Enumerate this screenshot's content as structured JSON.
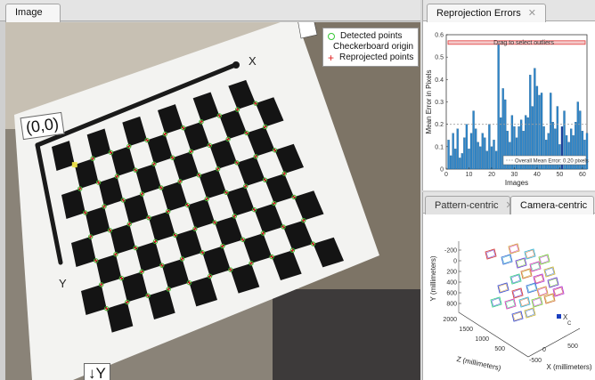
{
  "image_tab": {
    "label": "Image"
  },
  "legend": {
    "detected": "Detected points",
    "origin": "Checkerboard origin",
    "reprojected": "Reprojected points"
  },
  "overlay": {
    "origin_label": "(0,0)",
    "x_label": "X",
    "y_label": "Y",
    "y_arrow_label": "↓Y"
  },
  "reprojection_tab": {
    "label": "Reprojection Errors"
  },
  "pattern_tab": {
    "label": "Pattern-centric"
  },
  "camera_tab": {
    "label": "Camera-centric"
  },
  "colors": {
    "bar": "#2f86c9",
    "bar_edge": "#17517e",
    "mean_line": "#a0a0a0",
    "select_bar": "#e23b3b",
    "detected": "#37c837",
    "origin": "#f2e64c",
    "reprojected": "#e02020"
  },
  "chart_data": {
    "type": "bar",
    "ylabel": "Mean Error in Pixels",
    "xlabel": "Images",
    "drag_hint": "Drag to select outliers",
    "mean_label": "Overall Mean Error: 0.20 pixels",
    "mean_value": 0.2,
    "ylim": [
      0,
      0.6
    ],
    "xlim": [
      0,
      62
    ],
    "yticks": [
      "0",
      "0.1",
      "0.2",
      "0.3",
      "0.4",
      "0.5",
      "0.6"
    ],
    "xticks": [
      "0",
      "10",
      "20",
      "30",
      "40",
      "50",
      "60"
    ],
    "values": [
      0.13,
      0.06,
      0.16,
      0.09,
      0.18,
      0.05,
      0.07,
      0.14,
      0.2,
      0.09,
      0.16,
      0.26,
      0.18,
      0.12,
      0.1,
      0.16,
      0.14,
      0.08,
      0.2,
      0.1,
      0.13,
      0.08,
      0.57,
      0.23,
      0.36,
      0.31,
      0.17,
      0.12,
      0.24,
      0.19,
      0.14,
      0.19,
      0.22,
      0.17,
      0.24,
      0.23,
      0.42,
      0.28,
      0.45,
      0.37,
      0.33,
      0.34,
      0.19,
      0.13,
      0.16,
      0.34,
      0.21,
      0.18,
      0.28,
      0.11,
      0.19,
      0.26,
      0.15,
      0.12,
      0.18,
      0.15,
      0.21,
      0.3,
      0.26,
      0.17,
      0.13,
      0.16
    ],
    "highlight_index": 50
  },
  "camera_plot": {
    "ylabel": "Y (millimeters)",
    "zlabel": "Z (millimeters)",
    "xlabel": "X (millimeters)",
    "yticks": [
      "-200",
      "0",
      "200",
      "400",
      "600",
      "800"
    ],
    "zticks": [
      "2000",
      "1500",
      "1000",
      "500"
    ],
    "xticks": [
      "0",
      "-500",
      "500"
    ],
    "camera_label": "X",
    "camera_sub": "C"
  }
}
